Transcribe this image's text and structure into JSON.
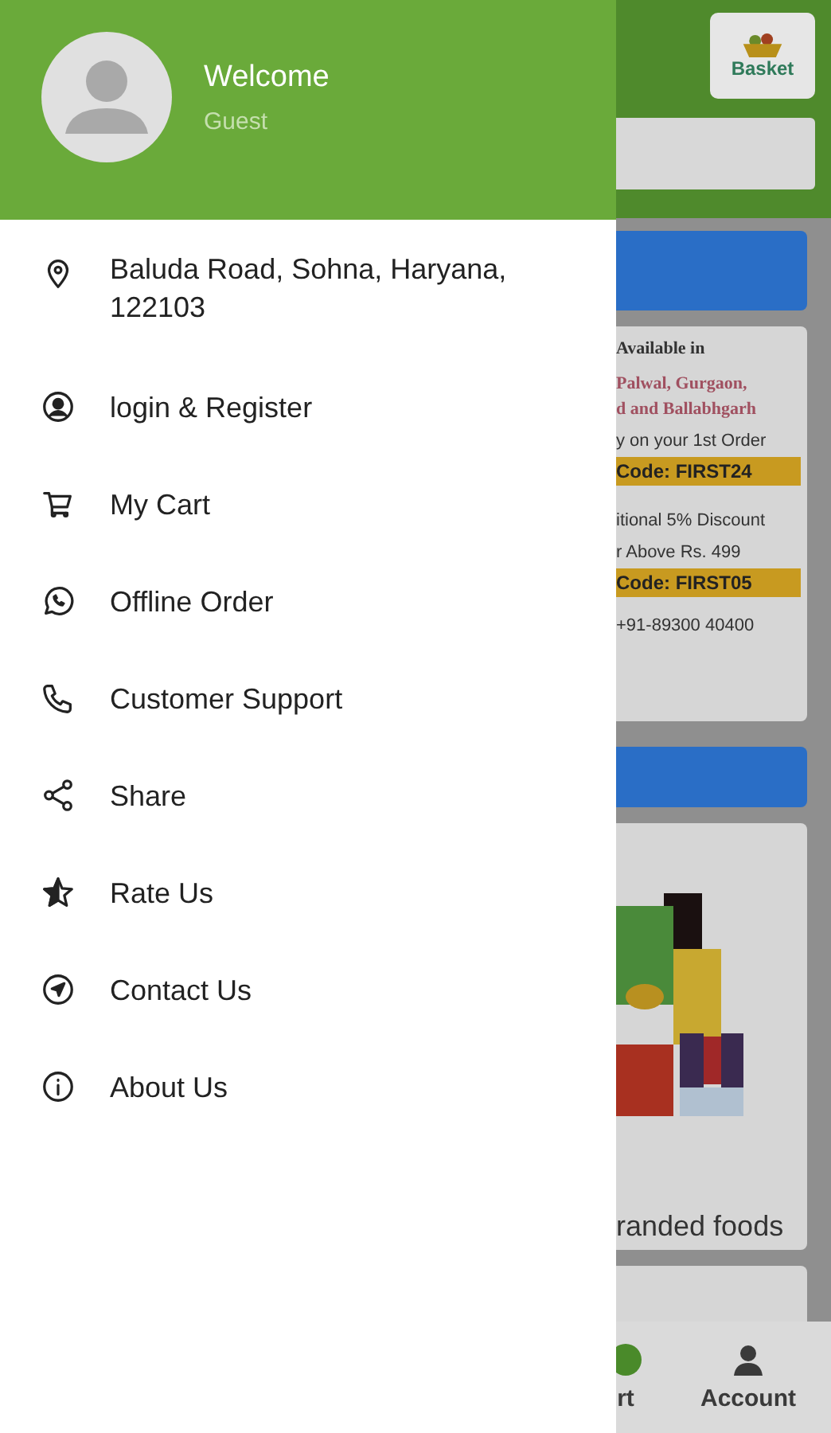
{
  "drawer": {
    "title": "Welcome",
    "subtitle": "Guest",
    "items": [
      {
        "kind": "location",
        "label": "Baluda Road, Sohna, Haryana, 122103"
      },
      {
        "kind": "account",
        "label": "login & Register"
      },
      {
        "kind": "cart",
        "label": "My Cart"
      },
      {
        "kind": "chat",
        "label": "Offline Order"
      },
      {
        "kind": "phone",
        "label": "Customer Support"
      },
      {
        "kind": "share",
        "label": "Share"
      },
      {
        "kind": "star",
        "label": "Rate Us"
      },
      {
        "kind": "navigate",
        "label": "Contact Us"
      },
      {
        "kind": "info",
        "label": "About Us"
      }
    ]
  },
  "background_page": {
    "logo_text": "Basket",
    "offer_card": {
      "lines": [
        {
          "kind": "heading",
          "text": "Available in"
        },
        {
          "kind": "city",
          "text": "Palwal,   Gurgaon,"
        },
        {
          "kind": "city",
          "text": "d and Ballabhgarh"
        },
        {
          "kind": "plain",
          "text": "y on your 1st Order"
        },
        {
          "kind": "code",
          "text": "Code: FIRST24"
        },
        {
          "kind": "plain",
          "text": "itional 5% Discount"
        },
        {
          "kind": "plain",
          "text": "r Above Rs. 499"
        },
        {
          "kind": "code",
          "text": "Code: FIRST05"
        },
        {
          "kind": "phone",
          "text": "+91-89300 40400"
        }
      ]
    },
    "category_card": {
      "kind": "picture",
      "title": "randed foods"
    },
    "bottom_nav": [
      {
        "label": "rt",
        "kind": "cart",
        "selected": false
      },
      {
        "label": "Account",
        "kind": "account",
        "selected": false
      }
    ]
  }
}
